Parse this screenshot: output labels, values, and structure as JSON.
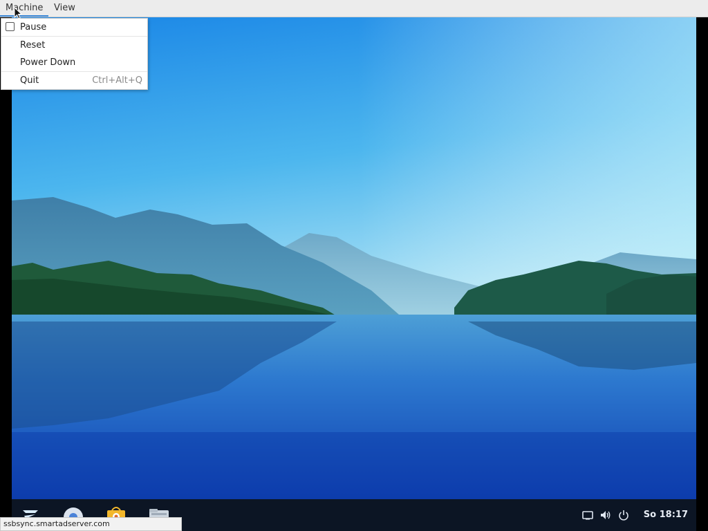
{
  "menubar": {
    "items": [
      {
        "label": "Machine"
      },
      {
        "label": "View"
      }
    ]
  },
  "machine_menu": {
    "items": [
      {
        "label": "Pause",
        "type": "checkbox",
        "checked": false
      },
      {
        "label": "Reset"
      },
      {
        "label": "Power Down"
      },
      {
        "label": "Quit",
        "shortcut": "Ctrl+Alt+Q"
      }
    ]
  },
  "desktop": {
    "wallpaper": "lake-mountains-landscape"
  },
  "taskbar": {
    "apps": [
      {
        "icon": "zorin-menu-icon"
      },
      {
        "icon": "web-browser-icon"
      },
      {
        "icon": "software-store-icon"
      },
      {
        "icon": "file-manager-icon"
      }
    ],
    "tray": [
      {
        "icon": "display-icon"
      },
      {
        "icon": "volume-icon"
      },
      {
        "icon": "power-icon"
      }
    ],
    "clock": "So 18:17"
  },
  "status_bar": {
    "text": "ssbsync.smartadserver.com"
  },
  "colors": {
    "menubar_bg": "#ececec",
    "menu_accent": "#3b87d6",
    "taskbar_bg": "#0c1524",
    "sky_top": "#1e8fe8",
    "lake": "#1a5fc8"
  }
}
